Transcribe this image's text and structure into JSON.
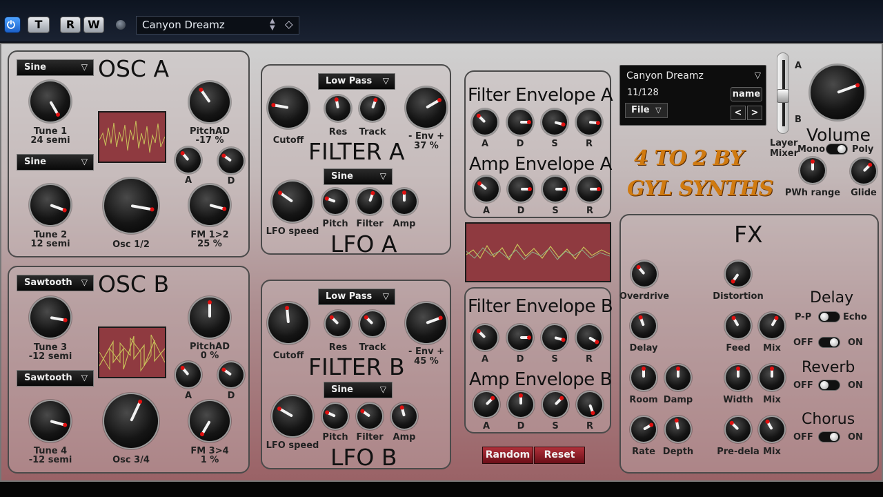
{
  "toolbar": {
    "power_icon": "power-icon",
    "t_label": "T",
    "r_label": "R",
    "w_label": "W",
    "preset_name": "Canyon Dreamz"
  },
  "osc_a": {
    "title": "OSC A",
    "wave1": "Sine",
    "wave2": "Sine",
    "tune1_label": "Tune 1",
    "tune1_value": "24 semi",
    "tune2_label": "Tune 2",
    "tune2_value": "12 semi",
    "mix_label": "Osc 1/2",
    "pitchad_label": "PitchAD",
    "pitchad_value": "-17 %",
    "a_label": "A",
    "d_label": "D",
    "fm_label": "FM 1>2",
    "fm_value": "25 %"
  },
  "osc_b": {
    "title": "OSC B",
    "wave1": "Sawtooth",
    "wave2": "Sawtooth",
    "tune3_label": "Tune 3",
    "tune3_value": "-12 semi",
    "tune4_label": "Tune 4",
    "tune4_value": "-12 semi",
    "mix_label": "Osc 3/4",
    "pitchad_label": "PitchAD",
    "pitchad_value": "0 %",
    "a_label": "A",
    "d_label": "D",
    "fm_label": "FM 3>4",
    "fm_value": "1 %"
  },
  "filter_a": {
    "title": "FILTER A",
    "type": "Low Pass",
    "cutoff_label": "Cutoff",
    "res_label": "Res",
    "track_label": "Track",
    "env_label": "- Env +",
    "env_value": "37 %"
  },
  "lfo_a": {
    "title": "LFO A",
    "wave": "Sine",
    "speed_label": "LFO speed",
    "pitch_label": "Pitch",
    "filter_label": "Filter",
    "amp_label": "Amp"
  },
  "filter_b": {
    "title": "FILTER B",
    "type": "Low Pass",
    "cutoff_label": "Cutoff",
    "res_label": "Res",
    "track_label": "Track",
    "env_label": "- Env +",
    "env_value": "45 %"
  },
  "lfo_b": {
    "title": "LFO B",
    "wave": "Sine",
    "speed_label": "LFO speed",
    "pitch_label": "Pitch",
    "filter_label": "Filter",
    "amp_label": "Amp"
  },
  "env_a": {
    "filter_title": "Filter Envelope A",
    "amp_title": "Amp Envelope A",
    "labels": [
      "A",
      "D",
      "S",
      "R"
    ]
  },
  "env_b": {
    "filter_title": "Filter Envelope B",
    "amp_title": "Amp Envelope B",
    "labels": [
      "A",
      "D",
      "S",
      "R"
    ]
  },
  "buttons": {
    "random": "Random",
    "reset": "Reset"
  },
  "preset": {
    "name": "Canyon Dreamz",
    "index": "11/128",
    "name_button": "name",
    "file_label": "File",
    "prev": "<",
    "next": ">"
  },
  "layer": {
    "a_label": "A",
    "b_label": "B",
    "title_line1": "Layer",
    "title_line2": "Mixer"
  },
  "master": {
    "volume_label": "Volume",
    "mono_label": "Mono",
    "poly_label": "Poly",
    "pwh_label": "PWh range",
    "glide_label": "Glide"
  },
  "signature": {
    "line1": "4 TO 2 BY",
    "line2": "GYL SYNTHS"
  },
  "fx": {
    "title": "FX",
    "overdrive_label": "Overdrive",
    "distortion_label": "Distortion",
    "delay_knob_label": "Delay",
    "room_label": "Room",
    "damp_label": "Damp",
    "rate_label": "Rate",
    "depth_label": "Depth",
    "delay_title": "Delay",
    "pp_label": "P-P",
    "echo_label": "Echo",
    "off_label": "OFF",
    "on_label": "ON",
    "feed_label": "Feed",
    "mix_label": "Mix",
    "reverb_title": "Reverb",
    "width_label": "Width",
    "chorus_title": "Chorus",
    "predelay_label": "Pre-dela"
  },
  "colors": {
    "panel_border": "#4a4a4a",
    "indicator_red": "#e01010",
    "waveform_bg": "#8f3a40",
    "signature_orange": "#d07a10",
    "button_red": "#a0202c"
  }
}
